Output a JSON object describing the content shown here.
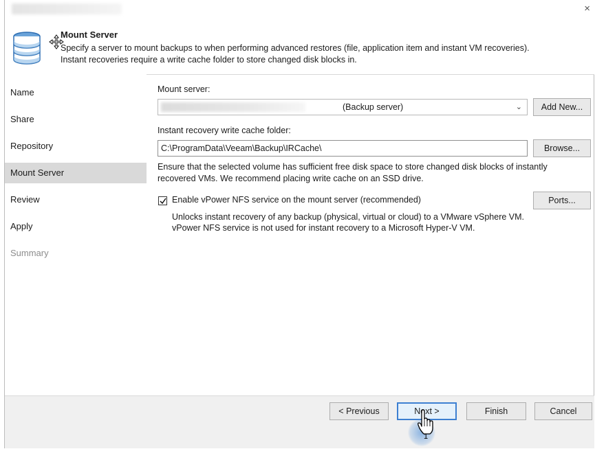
{
  "window": {
    "close_glyph": "×"
  },
  "header": {
    "title": "Mount Server",
    "description_line1": "Specify a server to mount backups to when performing advanced restores (file, application item and instant VM recoveries).",
    "description_line2": "Instant recoveries require a write cache folder to store changed disk blocks in.",
    "icon": "database-icon"
  },
  "steps": [
    {
      "label": "Name",
      "state": "normal"
    },
    {
      "label": "Share",
      "state": "normal"
    },
    {
      "label": "Repository",
      "state": "normal"
    },
    {
      "label": "Mount Server",
      "state": "active"
    },
    {
      "label": "Review",
      "state": "normal"
    },
    {
      "label": "Apply",
      "state": "normal"
    },
    {
      "label": "Summary",
      "state": "disabled"
    }
  ],
  "main": {
    "mount_server_label": "Mount server:",
    "mount_server_value": "(Backup server)",
    "add_new_button": "Add New...",
    "cache_folder_label": "Instant recovery write cache folder:",
    "cache_folder_value": "C:\\ProgramData\\Veeam\\Backup\\IRCache\\",
    "browse_button": "Browse...",
    "note_line1": "Ensure that the selected volume has sufficient free disk space to store changed disk blocks of instantly",
    "note_line2": "recovered VMs. We recommend placing write cache on an SSD drive.",
    "nfs_checkbox_checked": true,
    "nfs_checkbox_label": "Enable vPower NFS service on the mount server (recommended)",
    "ports_button": "Ports...",
    "nfs_note_line1": "Unlocks instant recovery of any backup (physical, virtual or cloud) to a VMware vSphere VM.",
    "nfs_note_line2": "vPower NFS service is not used for instant recovery to a Microsoft Hyper-V VM."
  },
  "footer": {
    "previous_button": "< Previous",
    "next_button": "Next >",
    "finish_button": "Finish",
    "cancel_button": "Cancel",
    "click_badge": "1"
  },
  "colors": {
    "accent": "#3c7fd1",
    "active_step_bg": "#d9d9d9",
    "footer_bg": "#f0f0f0"
  }
}
